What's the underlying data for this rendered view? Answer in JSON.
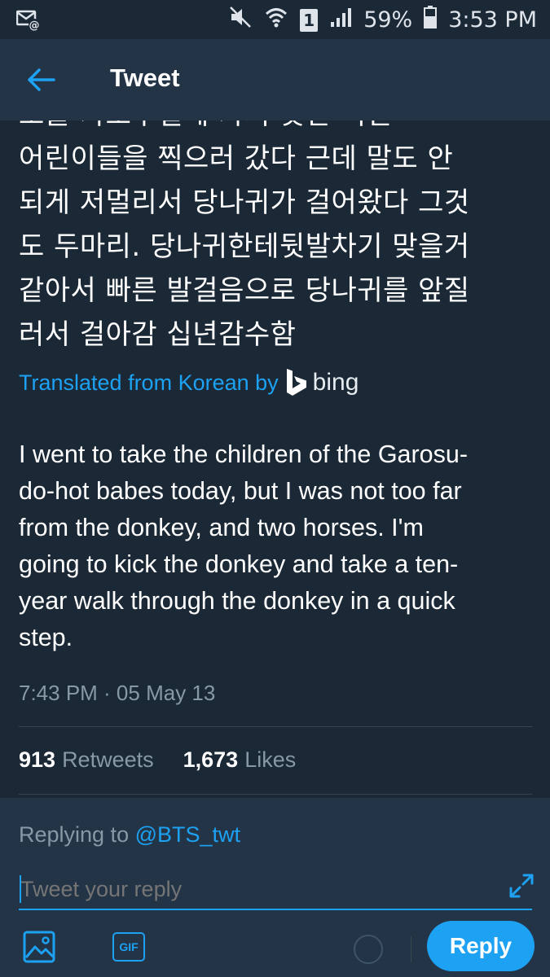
{
  "status_bar": {
    "left_icon": "sms-email-icon",
    "sim_slot": "1",
    "battery": "59%",
    "time": "3:53 PM"
  },
  "app_bar": {
    "title": "Tweet",
    "back_icon": "back-arrow-icon"
  },
  "tweet": {
    "korean_lines": [
      "오늘 가로수길에 가서 핫한 어린",
      "어린이들을 찍으러 갔다 근데 말도 안",
      "되게 저멀리서 당나귀가 걸어왔다 그것",
      "도 두마리. 당나귀한테뒷발차기 맞을거",
      "같아서 빠른 발걸음으로 당나귀를 앞질",
      "러서 걸아감 십년감수함"
    ],
    "translated_label": "Translated from Korean by",
    "translator": "bing",
    "translation_lines": [
      "I went to take the children of the Garosu-",
      "do-hot babes today, but I was not too far",
      "from the donkey, and two horses. I'm",
      "going to kick the donkey and take a ten-",
      "year walk through the donkey in a quick",
      "step."
    ],
    "timestamp": "7:43 PM · 05 May 13",
    "retweets_count": "913",
    "retweets_label": "Retweets",
    "likes_count": "1,673",
    "likes_label": "Likes"
  },
  "reply": {
    "replying_prefix": "Replying to",
    "replying_handle": "@BTS_twt",
    "placeholder": "Tweet your reply",
    "gif_label": "GIF",
    "button_label": "Reply"
  },
  "colors": {
    "background": "#1b2836",
    "app_bar": "#243447",
    "accent": "#1da1f2",
    "muted_text": "#8899a6",
    "divider": "#38444d"
  }
}
